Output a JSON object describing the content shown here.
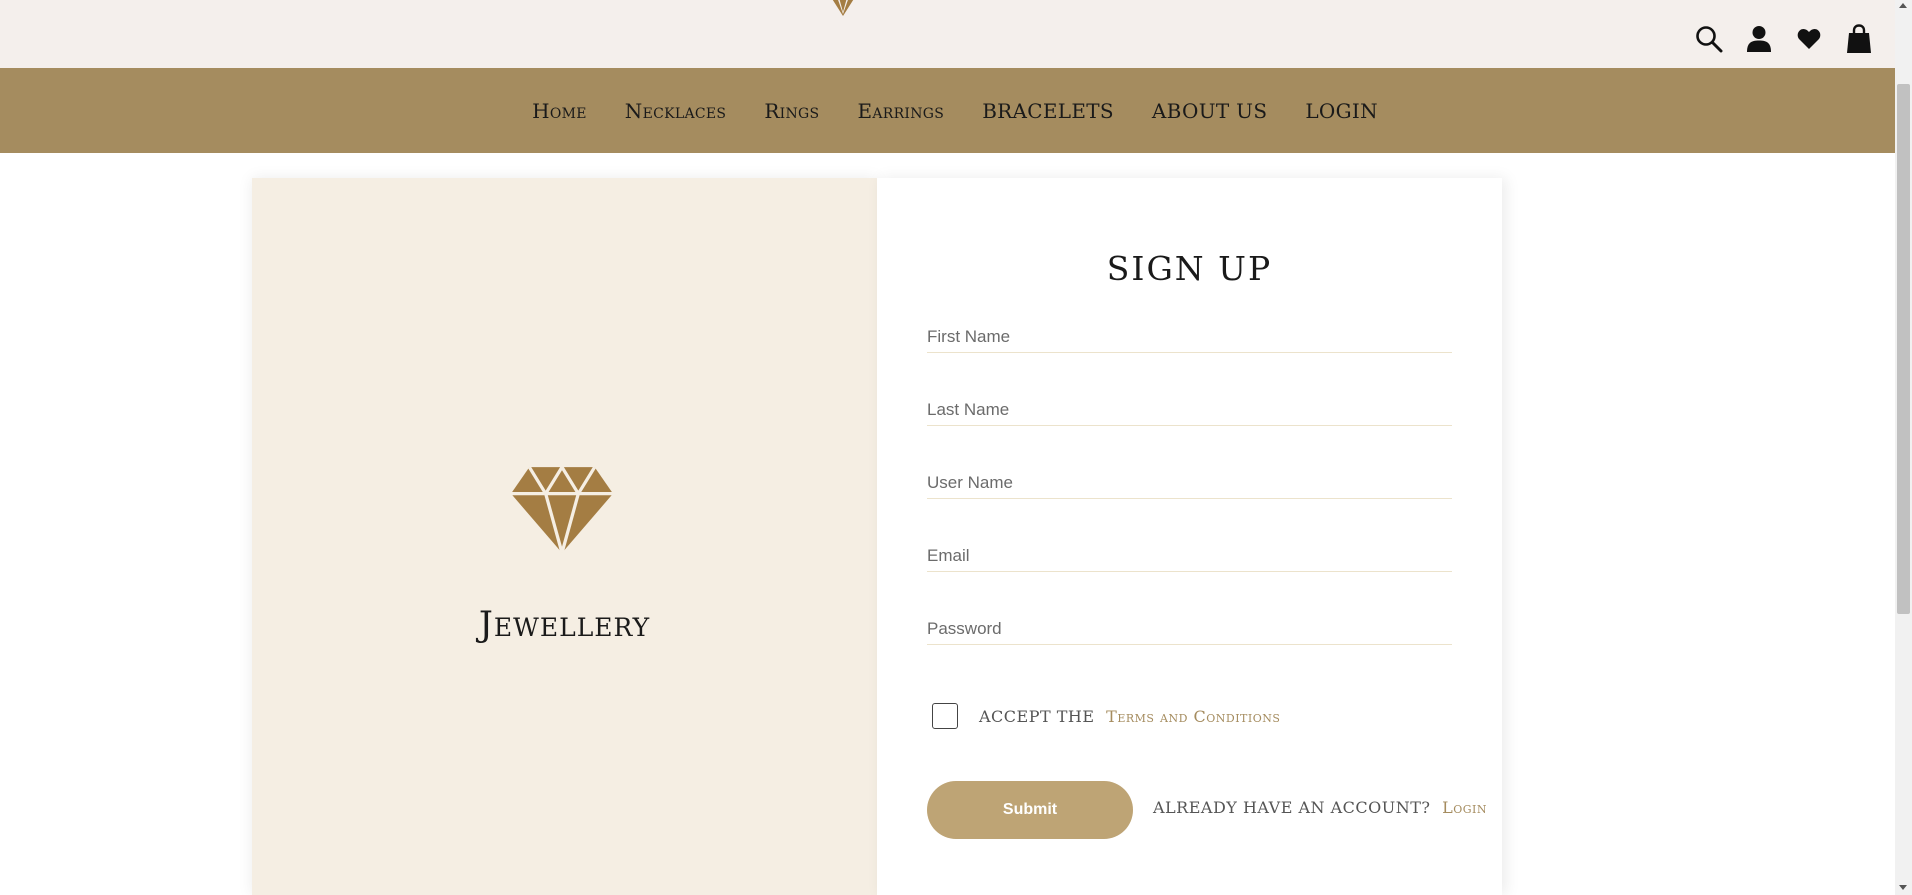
{
  "header": {
    "logo_icon": "diamond-icon",
    "icons": [
      "search-icon",
      "user-icon",
      "heart-icon",
      "shopping-bag-icon"
    ]
  },
  "nav": {
    "items": [
      "Home",
      "Necklaces",
      "Rings",
      "Earrings",
      "BRACELETS",
      "ABOUT US",
      "LOGIN"
    ]
  },
  "brand_panel": {
    "logo_icon": "diamond-icon",
    "name": "Jewellery"
  },
  "signup_form": {
    "title": "SIGN UP",
    "fields": {
      "first_name": {
        "placeholder": "First Name",
        "value": ""
      },
      "last_name": {
        "placeholder": "Last Name",
        "value": ""
      },
      "user_name": {
        "placeholder": "User Name",
        "value": ""
      },
      "email": {
        "placeholder": "Email",
        "value": ""
      },
      "password": {
        "placeholder": "Password",
        "value": ""
      }
    },
    "terms_prefix": "ACCEPT THE",
    "terms_link": "Terms and Conditions",
    "submit_label": "Submit",
    "login_prompt": "ALREADY HAVE AN ACCOUNT?",
    "login_link": "Login"
  },
  "colors": {
    "nav_background": "#a58c5f",
    "top_background": "#f4efec",
    "accent_gold": "#a58c5f",
    "button": "#bea475",
    "brand_panel_background": "#f5eee3",
    "diamond": "#a47d43"
  }
}
